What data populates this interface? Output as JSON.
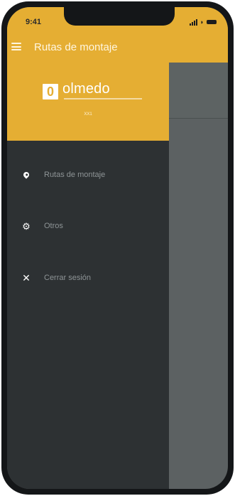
{
  "status": {
    "time": "9:41"
  },
  "appbar": {
    "title": "Rutas de montaje"
  },
  "drawer": {
    "logo_glyph": "0",
    "logo_text": "olmedo",
    "user_label": "XX1",
    "items": [
      {
        "label": "Rutas de montaje",
        "icon": "location-pin-icon"
      },
      {
        "label": "Otros",
        "icon": "gear-icon"
      },
      {
        "label": "Cerrar sesión",
        "icon": "close-icon"
      }
    ]
  },
  "colors": {
    "brand_yellow": "#e5ae33",
    "drawer_bg": "#2d3133",
    "scrim": "#5c6162"
  }
}
